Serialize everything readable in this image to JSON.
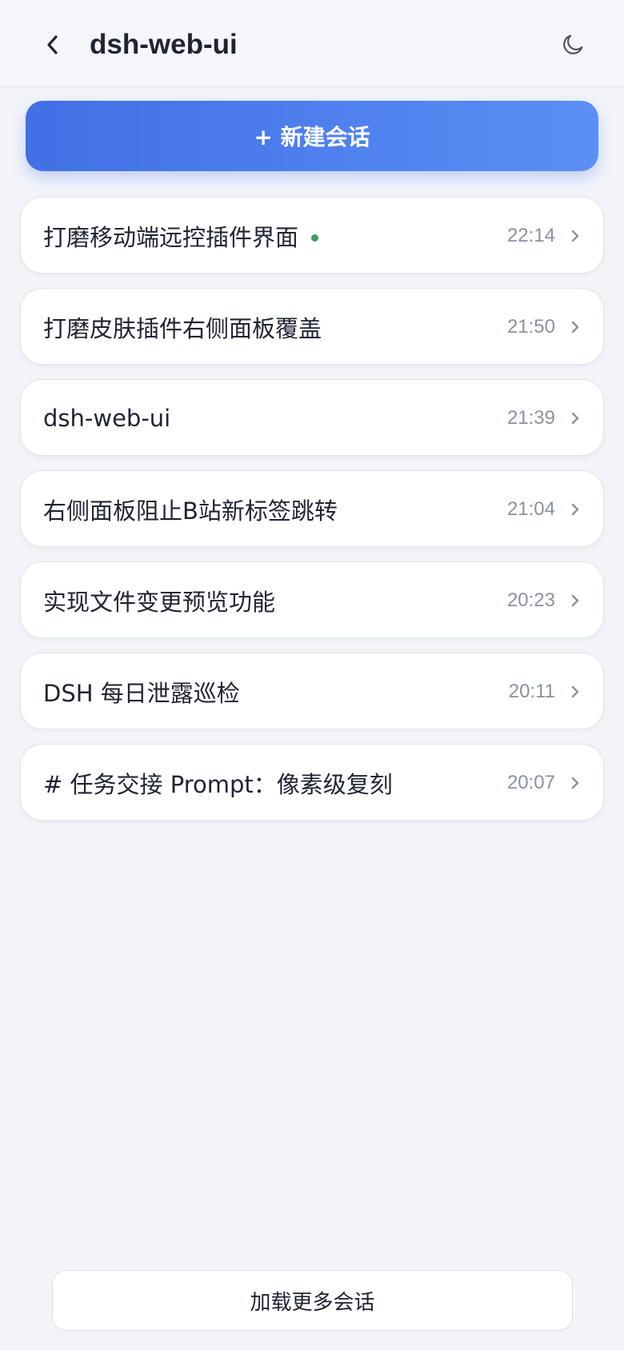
{
  "header": {
    "title": "dsh-web-ui",
    "back_icon": "chevron-left-icon",
    "theme_icon": "moon-icon"
  },
  "new_session": {
    "label": "+ 新建会话"
  },
  "sessions": [
    {
      "title": "打磨移动端远控插件界面",
      "time": "22:14",
      "active": true
    },
    {
      "title": "打磨皮肤插件右侧面板覆盖",
      "time": "21:50",
      "active": false
    },
    {
      "title": "dsh-web-ui",
      "time": "21:39",
      "active": false
    },
    {
      "title": "右侧面板阻止B站新标签跳转",
      "time": "21:04",
      "active": false
    },
    {
      "title": "实现文件变更预览功能",
      "time": "20:23",
      "active": false
    },
    {
      "title": "DSH 每日泄露巡检",
      "time": "20:11",
      "active": false
    },
    {
      "title": "# 任务交接 Prompt：像素级复刻",
      "time": "20:07",
      "active": false
    }
  ],
  "load_more": {
    "label": "加载更多会话"
  },
  "colors": {
    "accent_start": "#426fe6",
    "accent_end": "#5b8ff4",
    "active_dot": "#3d9a63",
    "background": "#f2f4f9"
  }
}
